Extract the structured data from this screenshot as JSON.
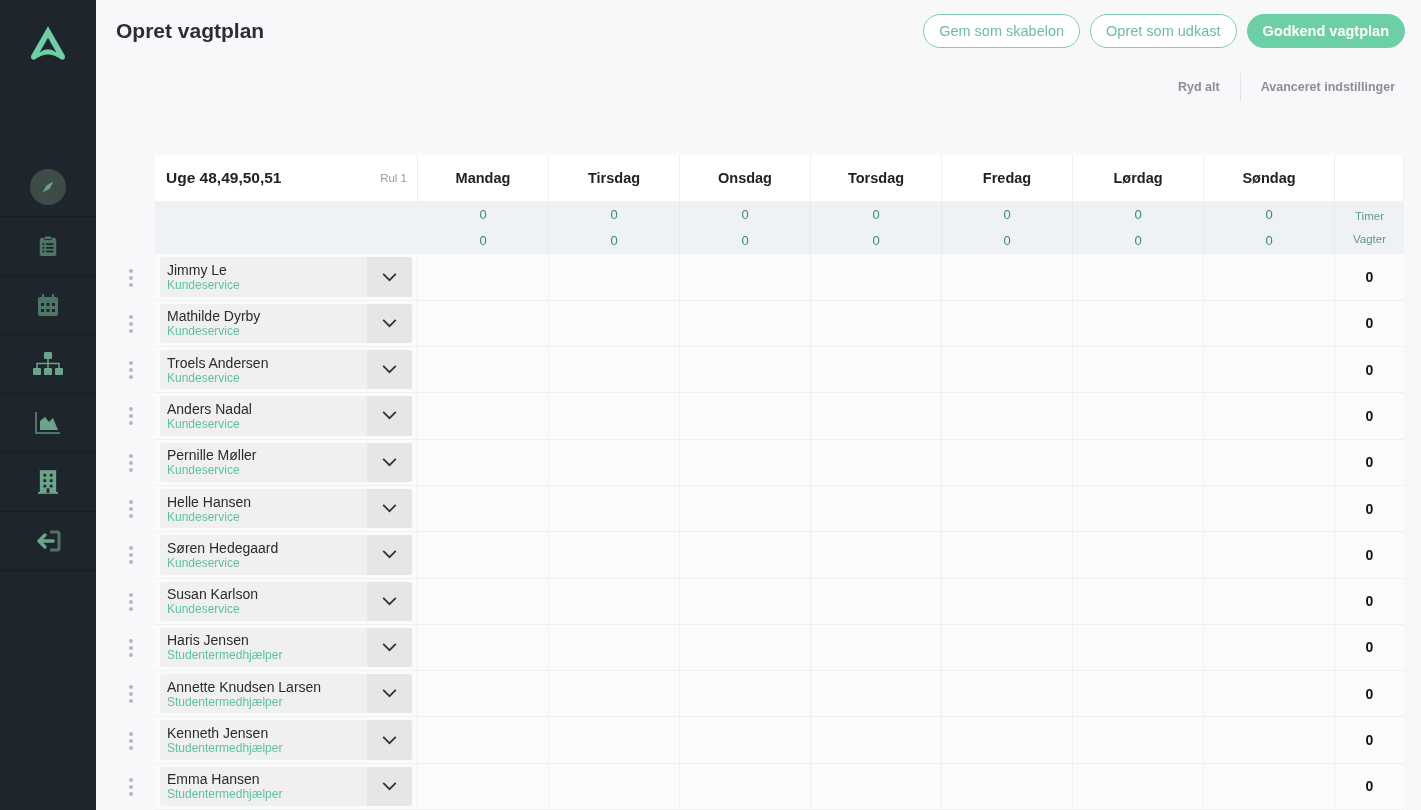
{
  "sidebar": {
    "items": [
      {
        "kind": "compass",
        "selected": true
      },
      {
        "kind": "clipboard",
        "selected": false
      },
      {
        "kind": "calendar",
        "selected": false
      },
      {
        "kind": "hierarchy",
        "selected": false
      },
      {
        "kind": "chart",
        "selected": false
      },
      {
        "kind": "building",
        "selected": false
      },
      {
        "kind": "logout",
        "selected": false
      }
    ]
  },
  "title": "Opret vagtplan",
  "actions": [
    {
      "label": "Gem som skabelon",
      "kind": "outline"
    },
    {
      "label": "Opret som udkast",
      "kind": "outline"
    },
    {
      "label": "Godkend vagtplan",
      "kind": "primary"
    }
  ],
  "links": [
    "Ryd alt",
    "Avanceret indstillinger"
  ],
  "schedule": {
    "weeks": "Uge 48,49,50,51",
    "rotation": "Rul 1",
    "days": [
      "Mandag",
      "Tirsdag",
      "Onsdag",
      "Torsdag",
      "Fredag",
      "Lørdag",
      "Søndag"
    ],
    "day_totals": [
      {
        "hours": "0",
        "shifts": "0"
      },
      {
        "hours": "0",
        "shifts": "0"
      },
      {
        "hours": "0",
        "shifts": "0"
      },
      {
        "hours": "0",
        "shifts": "0"
      },
      {
        "hours": "0",
        "shifts": "0"
      },
      {
        "hours": "0",
        "shifts": "0"
      },
      {
        "hours": "0",
        "shifts": "0"
      }
    ],
    "summary_labels": [
      "Timer",
      "Vagter"
    ],
    "employees": [
      {
        "name": "Jimmy Le",
        "department": "Kundeservice",
        "total": "0"
      },
      {
        "name": "Mathilde Dyrby",
        "department": "Kundeservice",
        "total": "0"
      },
      {
        "name": "Troels Andersen",
        "department": "Kundeservice",
        "total": "0"
      },
      {
        "name": "Anders Nadal",
        "department": "Kundeservice",
        "total": "0"
      },
      {
        "name": "Pernille Møller",
        "department": "Kundeservice",
        "total": "0"
      },
      {
        "name": "Helle Hansen",
        "department": "Kundeservice",
        "total": "0"
      },
      {
        "name": "Søren Hedegaard",
        "department": "Kundeservice",
        "total": "0"
      },
      {
        "name": "Susan Karlson",
        "department": "Kundeservice",
        "total": "0"
      },
      {
        "name": "Haris Jensen",
        "department": "Studentermedhjælper",
        "total": "0"
      },
      {
        "name": "Annette Knudsen Larsen",
        "department": "Studentermedhjælper",
        "total": "0"
      },
      {
        "name": "Kenneth Jensen",
        "department": "Studentermedhjælper",
        "total": "0"
      },
      {
        "name": "Emma Hansen",
        "department": "Studentermedhjælper",
        "total": "0"
      }
    ]
  }
}
